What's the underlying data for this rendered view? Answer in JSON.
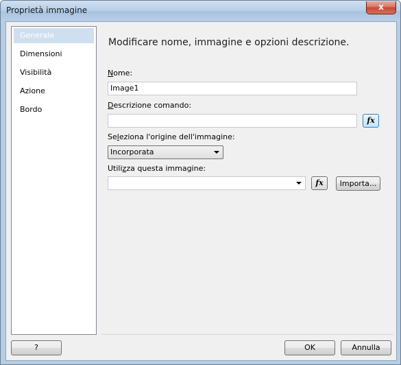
{
  "window": {
    "title": "Proprietà immagine",
    "close_label": "x"
  },
  "nav": {
    "items": [
      {
        "label": "Generale",
        "selected": true
      },
      {
        "label": "Dimensioni",
        "selected": false
      },
      {
        "label": "Visibilità",
        "selected": false
      },
      {
        "label": "Azione",
        "selected": false
      },
      {
        "label": "Bordo",
        "selected": false
      }
    ]
  },
  "main": {
    "heading": "Modificare nome, immagine e opzioni descrizione.",
    "name_label_hot": "N",
    "name_label_rest": "ome:",
    "name_value": "Image1",
    "tooltip_label_hot": "D",
    "tooltip_label_rest": "escrizione comando:",
    "tooltip_value": "",
    "source_label_pre": "Se",
    "source_label_hot": "l",
    "source_label_rest": "eziona l'origine dell'immagine:",
    "source_value": "Incorporata",
    "image_label_pre": "Utili",
    "image_label_hot": "z",
    "image_label_rest": "za questa immagine:",
    "image_value": "",
    "fx_label": "fx",
    "import_label": "Importa..."
  },
  "footer": {
    "help_label": "?",
    "ok_label": "OK",
    "cancel_label": "Annulla"
  }
}
